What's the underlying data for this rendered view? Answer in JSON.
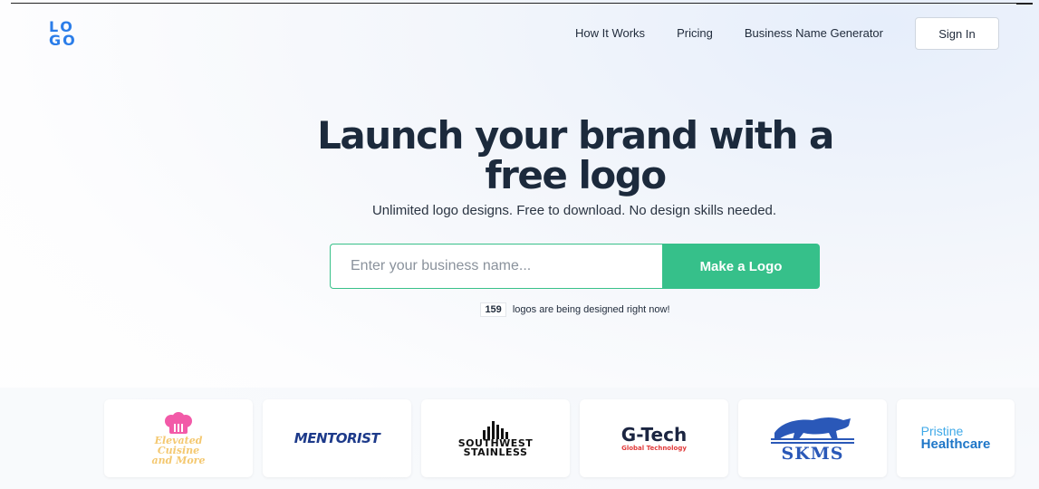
{
  "header": {
    "logo_letters": [
      "L",
      "O",
      "G",
      "O"
    ],
    "nav": [
      {
        "label": "How It Works"
      },
      {
        "label": "Pricing"
      },
      {
        "label": "Business Name Generator"
      }
    ],
    "signin_label": "Sign In"
  },
  "hero": {
    "headline_line1": "Launch your brand with a",
    "headline_line2": "free logo",
    "subheadline": "Unlimited logo designs. Free to download. No design skills needed.",
    "input_placeholder": "Enter your business name...",
    "input_value": "",
    "button_label": "Make a Logo",
    "counter_value": "159",
    "counter_text": "logos are being designed right now!"
  },
  "samples": [
    {
      "name": "Elevated Cuisine and More",
      "lines": [
        "Elevated",
        "Cuisine",
        "and More"
      ]
    },
    {
      "name": "MENTORIST"
    },
    {
      "name": "SOUTHWEST STAINLESS",
      "lines": [
        "SOUTHWEST",
        "STAINLESS"
      ]
    },
    {
      "name": "G-Tech",
      "tagline": "Global Technology"
    },
    {
      "name": "SKMS"
    },
    {
      "name": "Pristine Healthcare",
      "lines": [
        "Pristine",
        "Healthcare"
      ]
    }
  ],
  "colors": {
    "brand_blue": "#2b7de9",
    "cta_green": "#36c08a",
    "headline": "#1c2a3c"
  }
}
